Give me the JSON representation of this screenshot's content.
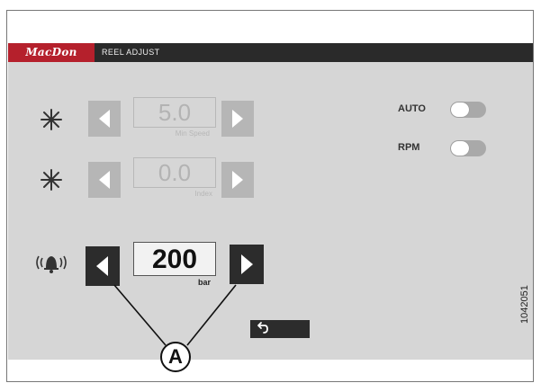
{
  "header": {
    "logo": "MacDon",
    "title": "REEL ADJUST"
  },
  "controls": [
    {
      "icon": "reel-speed-icon",
      "value": "5.0",
      "sublabel": "Min Speed",
      "state": "dim"
    },
    {
      "icon": "reel-index-icon",
      "value": "0.0",
      "sublabel": "Index",
      "state": "dim"
    },
    {
      "icon": "alarm-bell-icon",
      "value": "200",
      "sublabel": "bar",
      "state": "active"
    }
  ],
  "toggles": [
    {
      "label": "AUTO",
      "on": false
    },
    {
      "label": "RPM",
      "on": false
    }
  ],
  "callout": {
    "letter": "A"
  },
  "figure_number": "1042051",
  "colors": {
    "brand_red": "#b5202c",
    "title_bar": "#2a2a2a",
    "panel": "#d6d6d6",
    "dim_button": "#b6b6b6",
    "active_button": "#2c2c2c"
  }
}
